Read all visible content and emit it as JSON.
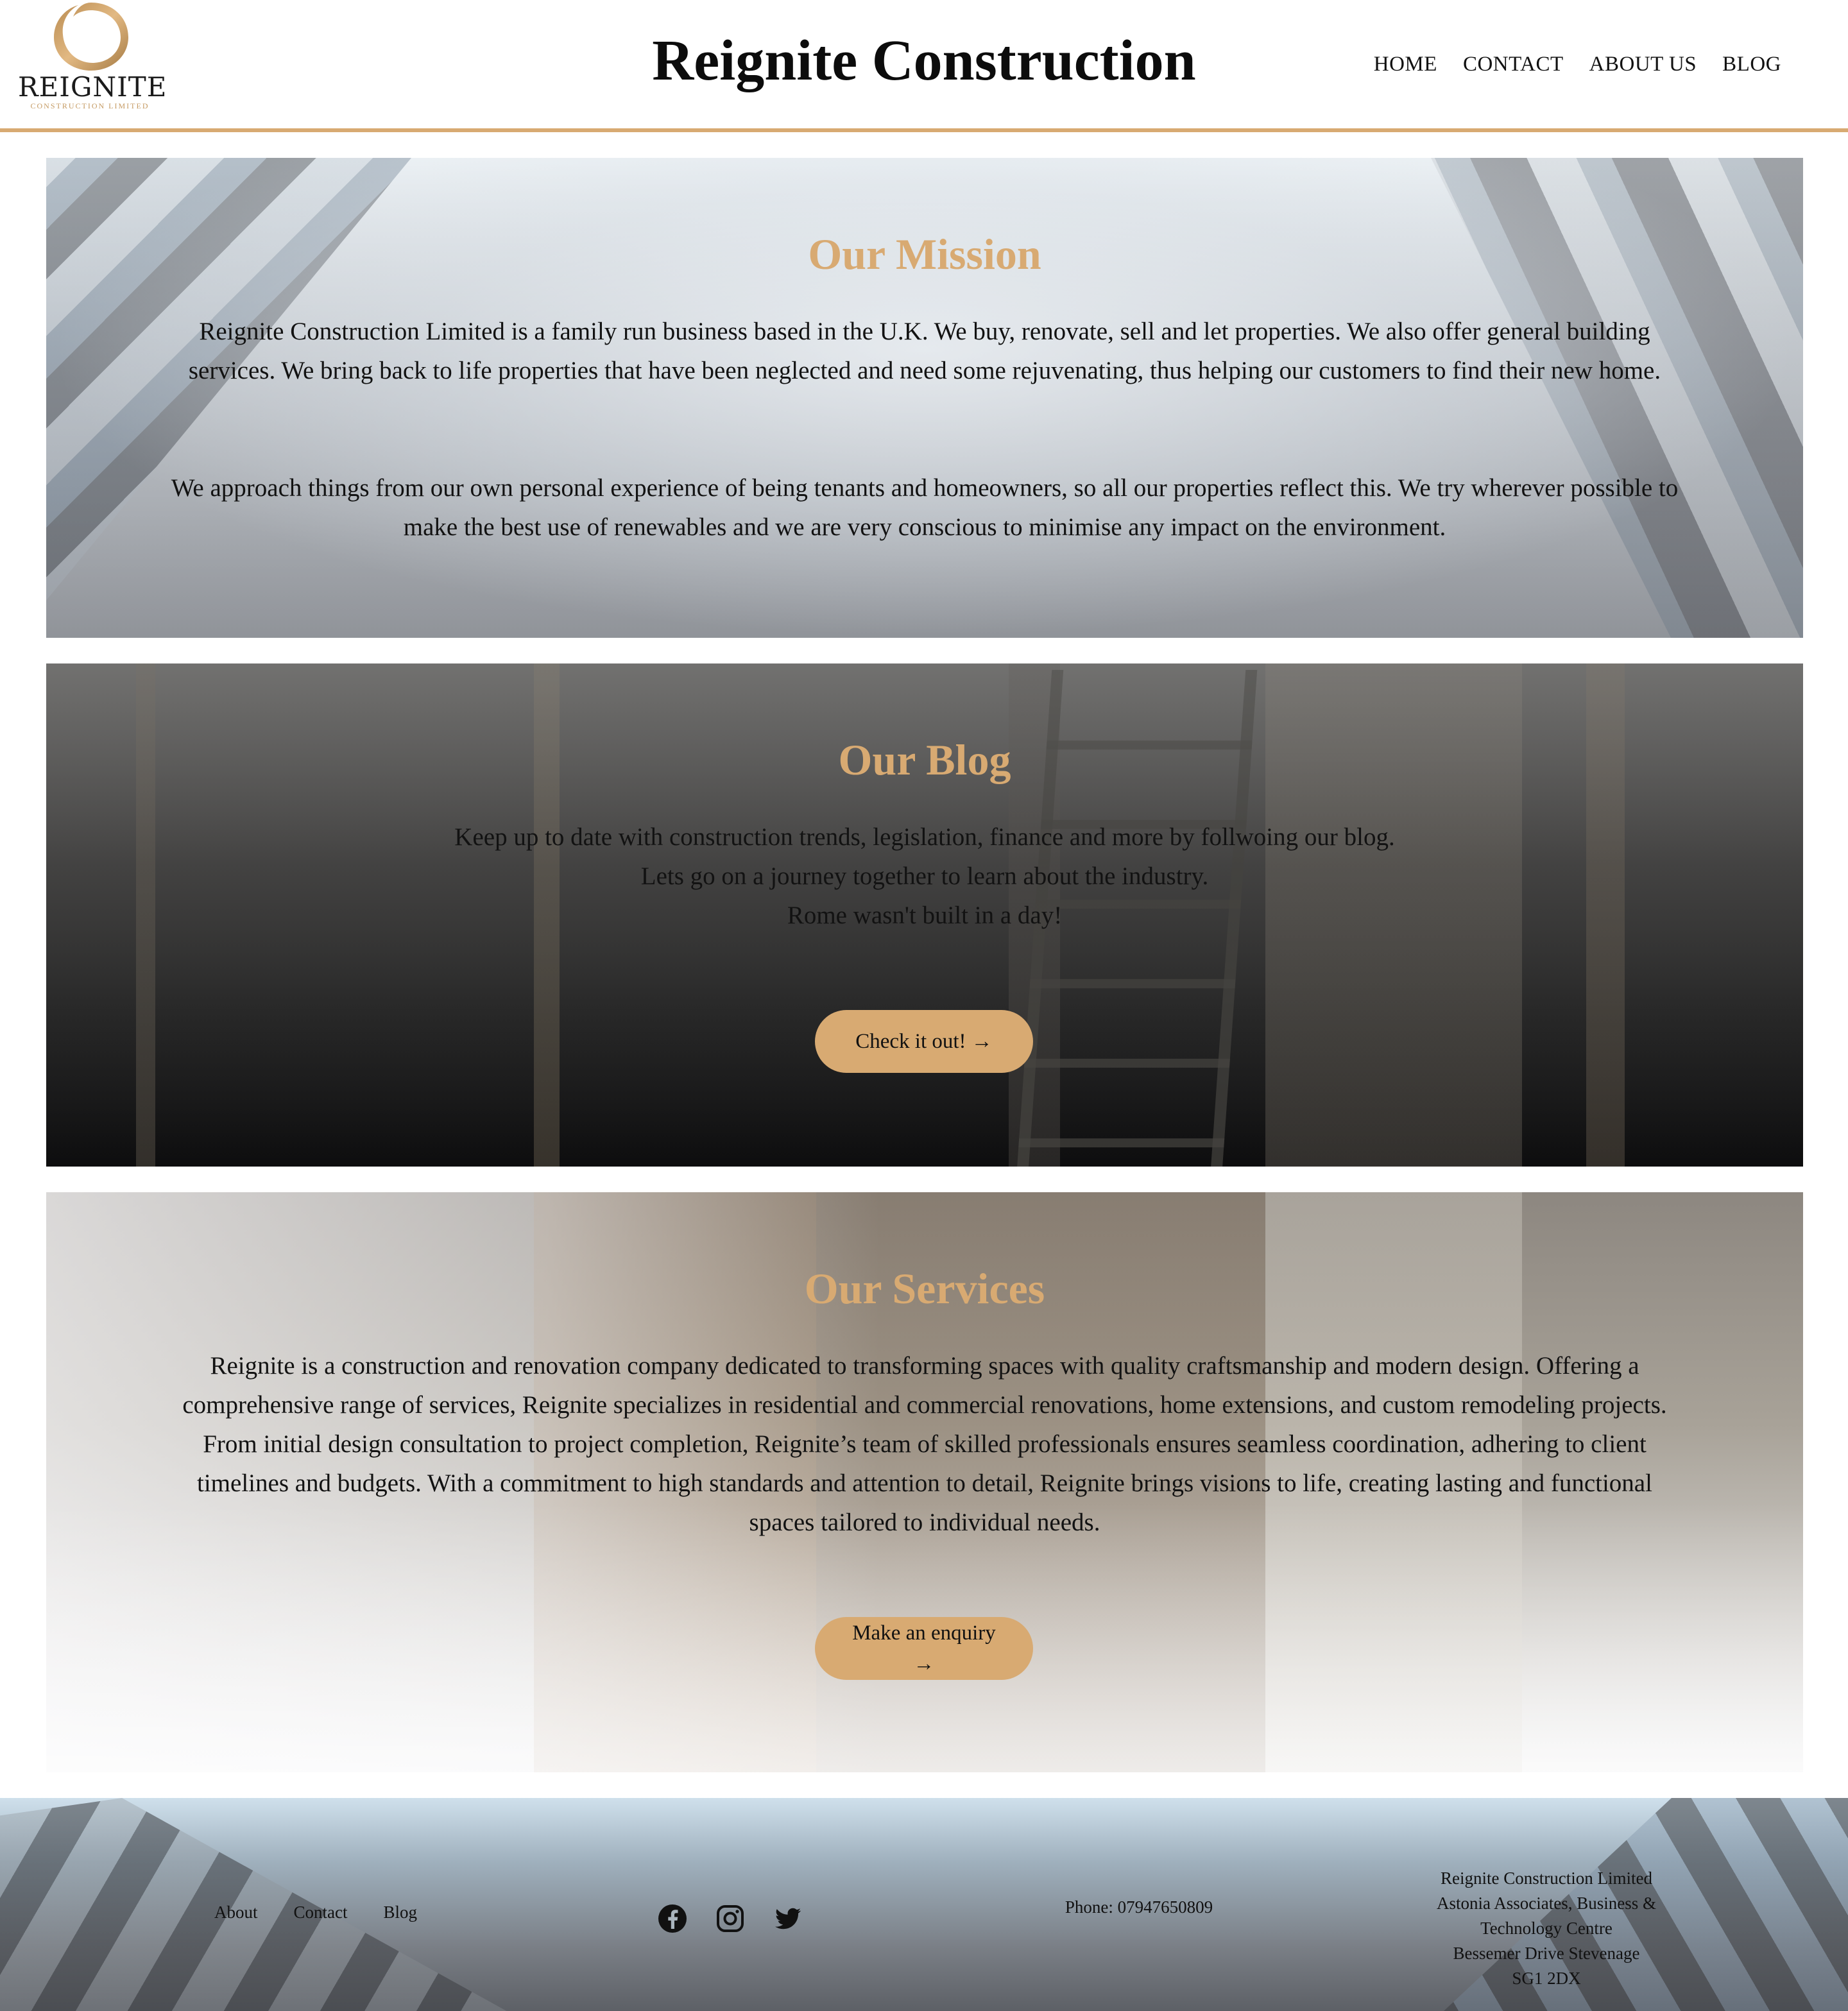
{
  "header": {
    "logo_word": "REIGNITE",
    "logo_sub": "CONSTRUCTION LIMITED",
    "site_title": "Reignite Construction",
    "nav": [
      "HOME",
      "CONTACT",
      "ABOUT US",
      "BLOG"
    ]
  },
  "mission": {
    "title": "Our Mission",
    "p1": "Reignite Construction Limited is a family run business based in the U.K. We buy, renovate, sell and let properties. We also offer general building services. We bring back to life properties that have been neglected and need some rejuvenating, thus helping our customers to find their new home.",
    "p2": "We approach things from our own personal experience of being tenants and homeowners, so all our properties reflect this. We try wherever possible to make the best use of renewables and we are very conscious to minimise any impact on the environment."
  },
  "blog": {
    "title": "Our Blog",
    "lines": [
      "Keep up to date with construction trends, legislation, finance and more by follwoing our blog.",
      "Lets go on a journey together to learn about the industry.",
      "Rome wasn't built in a day!"
    ],
    "cta": "Check it out! →"
  },
  "services": {
    "title": "Our Services",
    "p": "Reignite is a construction and renovation company dedicated to transforming spaces with quality craftsmanship and modern design. Offering a comprehensive range of services, Reignite specializes in residential and commercial renovations, home extensions, and custom remodeling projects. From initial design consultation to project completion, Reignite’s team of skilled professionals ensures seamless coordination, adhering to client timelines and budgets. With a commitment to high standards and attention to detail, Reignite brings visions to life, creating lasting and functional spaces tailored to individual needs.",
    "cta": "Make an enquiry →"
  },
  "footer": {
    "links": [
      "About",
      "Contact",
      "Blog"
    ],
    "social_icons": [
      "facebook-icon",
      "instagram-icon",
      "twitter-icon"
    ],
    "phone": "Phone: 07947650809",
    "address": [
      "Reignite Construction Limited",
      "Astonia Associates, Business &",
      "Technology Centre",
      "Bessemer Drive Stevenage",
      "SG1 2DX"
    ]
  },
  "colors": {
    "accent": "#d8aa72",
    "text": "#111111",
    "background": "#ffffff"
  }
}
